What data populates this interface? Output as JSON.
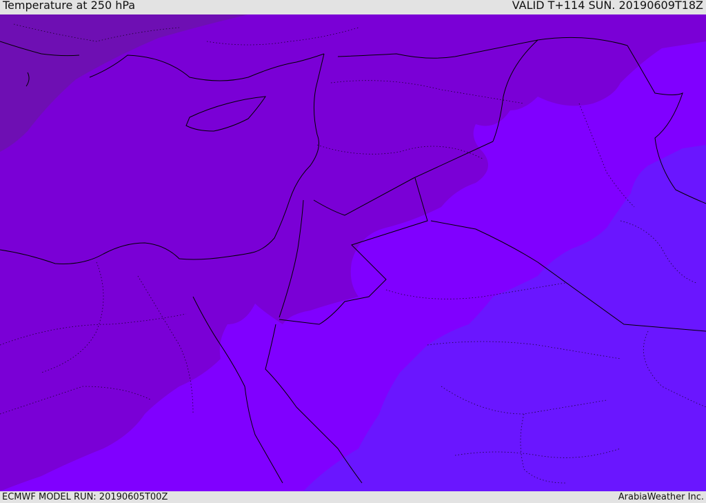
{
  "header": {
    "title": "Temperature at 250 hPa",
    "valid": "VALID T+114 SUN. 20190609T18Z"
  },
  "footer": {
    "model_run": "ECMWF MODEL RUN: 20190605T00Z",
    "credit": "ArabiaWeather Inc."
  },
  "colors": {
    "band_darkest": "#6e0fb3",
    "band_dark": "#7a00d6",
    "band_mid": "#8000ff",
    "band_blue": "#6a16ff",
    "borders": "#000000"
  }
}
